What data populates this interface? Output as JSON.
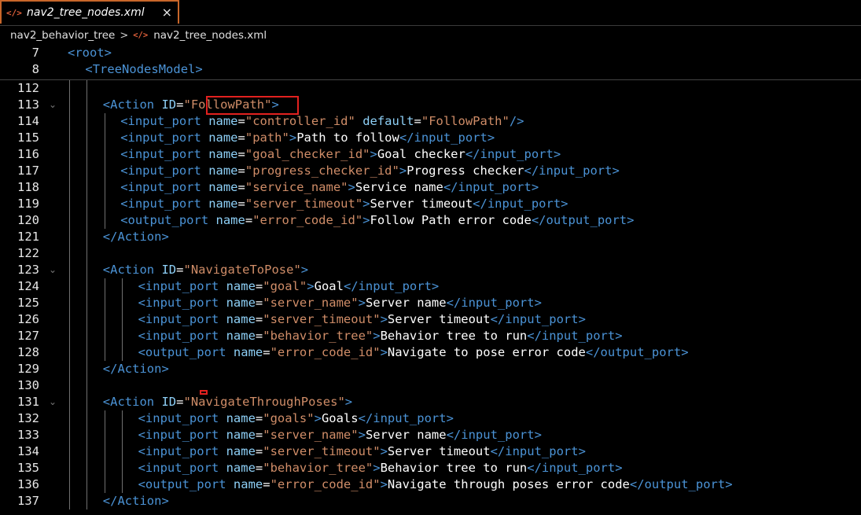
{
  "tab": {
    "icon": "xml-file-icon",
    "filename": "nav2_tree_nodes.xml",
    "close": "×",
    "accent": "#c8662a"
  },
  "breadcrumb": {
    "folder": "nav2_behavior_tree",
    "separator": ">",
    "file": "nav2_tree_nodes.xml"
  },
  "sticky_lines": [
    {
      "num": "7",
      "text": "<root>"
    },
    {
      "num": "8",
      "text": "<TreeNodesModel>"
    }
  ],
  "lines": [
    {
      "num": "112",
      "text": ""
    },
    {
      "num": "113",
      "text": "<Action ID=\"FollowPath\">"
    },
    {
      "num": "114",
      "text": "<input_port name=\"controller_id\" default=\"FollowPath\"/>"
    },
    {
      "num": "115",
      "text": "<input_port name=\"path\">Path to follow</input_port>"
    },
    {
      "num": "116",
      "text": "<input_port name=\"goal_checker_id\">Goal checker</input_port>"
    },
    {
      "num": "117",
      "text": "<input_port name=\"progress_checker_id\">Progress checker</input_port>"
    },
    {
      "num": "118",
      "text": "<input_port name=\"service_name\">Service name</input_port>"
    },
    {
      "num": "119",
      "text": "<input_port name=\"server_timeout\">Server timeout</input_port>"
    },
    {
      "num": "120",
      "text": "<output_port name=\"error_code_id\">Follow Path error code</output_port>"
    },
    {
      "num": "121",
      "text": "</Action>"
    },
    {
      "num": "122",
      "text": ""
    },
    {
      "num": "123",
      "text": "<Action ID=\"NavigateToPose\">"
    },
    {
      "num": "124",
      "text": "<input_port name=\"goal\">Goal</input_port>"
    },
    {
      "num": "125",
      "text": "<input_port name=\"server_name\">Server name</input_port>"
    },
    {
      "num": "126",
      "text": "<input_port name=\"server_timeout\">Server timeout</input_port>"
    },
    {
      "num": "127",
      "text": "<input_port name=\"behavior_tree\">Behavior tree to run</input_port>"
    },
    {
      "num": "128",
      "text": "<output_port name=\"error_code_id\">Navigate to pose error code</output_port>"
    },
    {
      "num": "129",
      "text": "</Action>"
    },
    {
      "num": "130",
      "text": ""
    },
    {
      "num": "131",
      "text": "<Action ID=\"NavigateThroughPoses\">"
    },
    {
      "num": "132",
      "text": "<input_port name=\"goals\">Goals</input_port>"
    },
    {
      "num": "133",
      "text": "<input_port name=\"server_name\">Server name</input_port>"
    },
    {
      "num": "134",
      "text": "<input_port name=\"server_timeout\">Server timeout</input_port>"
    },
    {
      "num": "135",
      "text": "<input_port name=\"behavior_tree\">Behavior tree to run</input_port>"
    },
    {
      "num": "136",
      "text": "<output_port name=\"error_code_id\">Navigate through poses error code</output_port>"
    },
    {
      "num": "137",
      "text": "</Action>"
    }
  ],
  "folded_lines": [
    "113",
    "123",
    "131"
  ],
  "highlight": {
    "line": "113",
    "token": "FollowPath",
    "color": "#e2211f"
  },
  "colors": {
    "tag": "#4b93d6",
    "attribute": "#8ed0f7",
    "string": "#d08d68",
    "text": "#ffffff",
    "background": "#000000"
  }
}
